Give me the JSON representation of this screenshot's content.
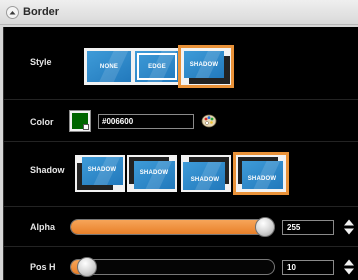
{
  "header": {
    "title": "Border",
    "collapse_icon": "chevron-up-icon"
  },
  "style_row": {
    "label": "Style",
    "options": [
      {
        "label": "NONE",
        "selected": false
      },
      {
        "label": "EDGE",
        "selected": false
      },
      {
        "label": "SHADOW",
        "selected": true
      }
    ]
  },
  "color_row": {
    "label": "Color",
    "swatch_color": "#006600",
    "hex_value": "#006600",
    "picker_icon": "color-palette-icon"
  },
  "shadow_row": {
    "label": "Shadow",
    "options": [
      {
        "label": "SHADOW",
        "selected": false
      },
      {
        "label": "SHADOW",
        "selected": false
      },
      {
        "label": "SHADOW",
        "selected": false
      },
      {
        "label": "SHADOW",
        "selected": true
      }
    ]
  },
  "alpha_row": {
    "label": "Alpha",
    "value": "255",
    "fraction": 1.0
  },
  "posh_row": {
    "label": "Pos H",
    "value": "10",
    "fraction": 0.04
  },
  "colors": {
    "accent": "#e99239",
    "panel_bg": "#000000",
    "thumb_blue": "#2e86c8"
  }
}
